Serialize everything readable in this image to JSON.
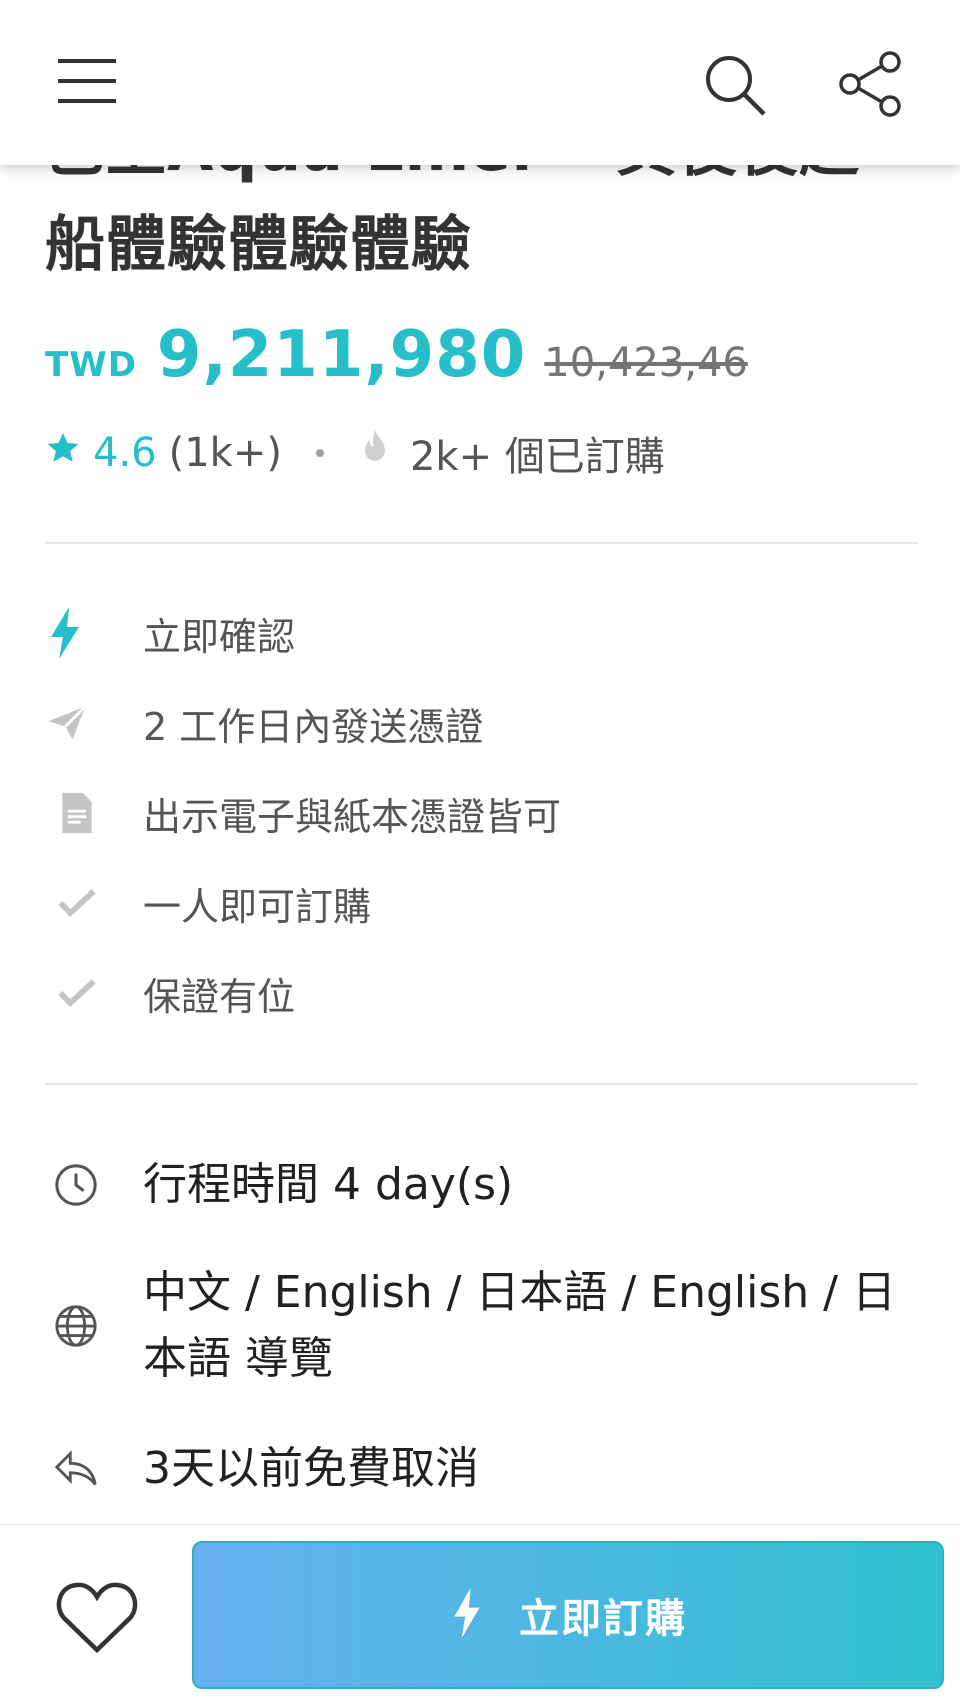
{
  "product": {
    "title_line_1": "巴上Aqua Linel  一頁役役超",
    "title_line_2": "船體驗體驗體驗"
  },
  "pricing": {
    "currency": "TWD",
    "price": "9,211,980",
    "original_price": "10,423,46"
  },
  "rating": {
    "value": "4.6",
    "count": "(1k+)",
    "booked": "2k+ 個已訂購"
  },
  "features": [
    {
      "icon": "lightning-icon",
      "label": "立即確認"
    },
    {
      "icon": "paper-plane-icon",
      "label": "2 工作日內發送憑證"
    },
    {
      "icon": "document-icon",
      "label": "出示電子與紙本憑證皆可"
    },
    {
      "icon": "check-icon",
      "label": "一人即可訂購"
    },
    {
      "icon": "check-icon",
      "label": "保證有位"
    }
  ],
  "info": {
    "duration": "行程時間 4 day(s)",
    "languages": "中文 / English / 日本語 / English / 日本語 導覽",
    "cancellation": "3天以前免費取消"
  },
  "actions": {
    "book_label": "立即訂購"
  },
  "colors": {
    "accent": "#26bec9",
    "button_gradient_start": "#67b0f1",
    "button_gradient_end": "#2fc0cf"
  }
}
